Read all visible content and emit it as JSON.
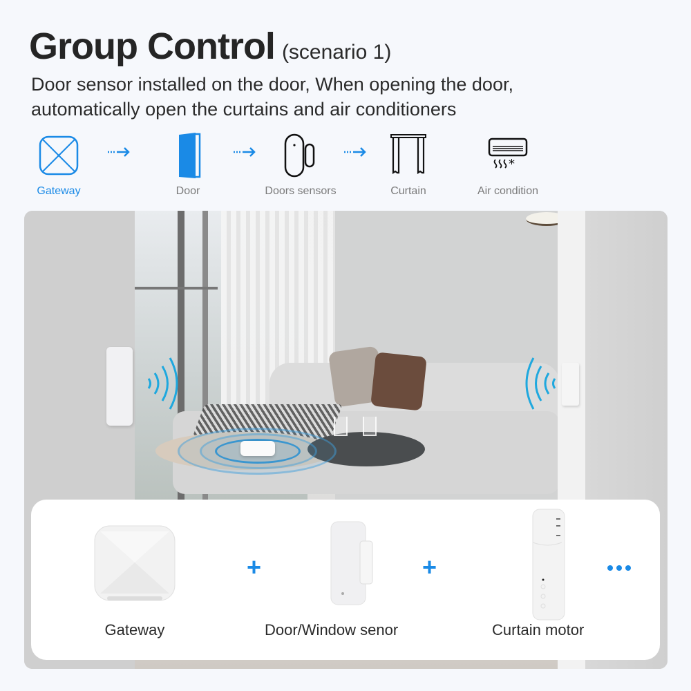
{
  "header": {
    "title": "Group Control",
    "subtitle": "(scenario 1)",
    "description_line1": "Door sensor installed on the door, When opening the door,",
    "description_line2": "automatically open the curtains and air conditioners"
  },
  "flow": {
    "accent_color": "#1a8ae6",
    "items": [
      {
        "label": "Gateway",
        "icon": "gateway-icon",
        "active": true
      },
      {
        "label": "Door",
        "icon": "door-icon",
        "active": false
      },
      {
        "label": "Doors sensors",
        "icon": "door-sensor-icon",
        "active": false
      },
      {
        "label": "Curtain",
        "icon": "curtain-icon",
        "active": false
      },
      {
        "label": "Air condition",
        "icon": "air-conditioner-icon",
        "active": false
      }
    ],
    "arrow_icon": "dotted-arrow-right-icon"
  },
  "scene": {
    "description": "Living room photo with door sensor, gateway hub on coffee table and wireless signal waves"
  },
  "products": {
    "items": [
      {
        "name": "Gateway",
        "icon": "gateway-device"
      },
      {
        "name": "Door/Window senor",
        "icon": "door-window-sensor-device"
      },
      {
        "name": "Curtain motor",
        "icon": "curtain-motor-device"
      }
    ],
    "separator": "+",
    "more_icon": "more-dots-icon"
  }
}
